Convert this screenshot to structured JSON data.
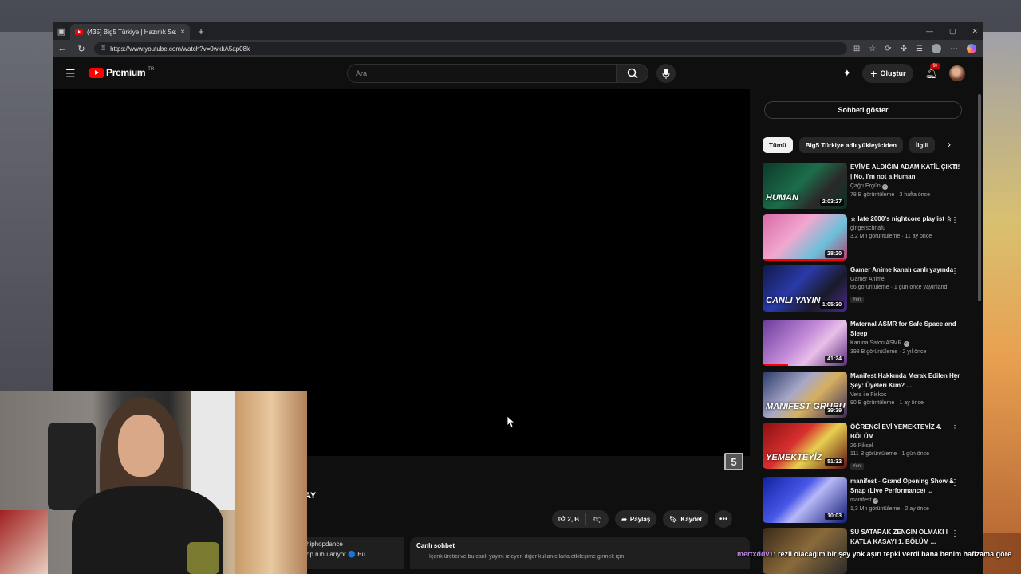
{
  "browser": {
    "tab_title": "(435) Big5 Türkiye | Hazırlık Sezon",
    "tab_close": "×",
    "new_tab": "+",
    "url": "https://www.youtube.com/watch?v=0wkkA5ap08k",
    "window_controls": [
      "—",
      "▢",
      "✕"
    ]
  },
  "header": {
    "logo_text": "Premium",
    "logo_country": "TR",
    "search_placeholder": "Ara",
    "create_label": "Oluştur",
    "notification_count": "9+"
  },
  "player": {
    "channel_logo_glyph": "5",
    "title_fragment": "AY"
  },
  "actions": {
    "like_count": "2, B",
    "share_label": "Paylaş",
    "save_label": "Kaydet"
  },
  "description": {
    "line1": "hiphopdance",
    "line2": "op ruhu arıyor 🔵 Bu"
  },
  "live_chat": {
    "title": "Canlı sohbet",
    "subtitle": "İçerik üretici ve bu canlı yayını izleyen diğer kullanıcılarla etkileşime girmek için"
  },
  "sidebar": {
    "show_chat_label": "Sohbeti göster",
    "chips": [
      "Tümü",
      "Big5 Türkiye adlı yükleyiciden",
      "İlgili"
    ],
    "recommendations": [
      {
        "title": "EVİME ALDIĞIM ADAM KATİL ÇIKTI! | No, I'm not a Human",
        "channel": "Çağrı Ergün",
        "verified": true,
        "meta": "78 B görüntüleme · 3 hafta önce",
        "duration": "2:03:27",
        "thumb_text": "HUMAN",
        "badge": "",
        "watched_fraction": 0
      },
      {
        "title": "☆ late 2000's nightcore playlist ☆",
        "channel": "gingerschnafu",
        "verified": false,
        "meta": "3,2 Mn görüntüleme · 11 ay önce",
        "duration": "28:20",
        "thumb_text": "",
        "badge": "",
        "watched_fraction": 1.0
      },
      {
        "title": "Gamer Anime kanalı canlı yayında",
        "channel": "Gamer Anime",
        "verified": false,
        "meta": "66 görüntüleme · 1 gün önce yayınlandı",
        "duration": "1:05:30",
        "thumb_text": "CANLI YAYIN",
        "badge": "Yeni",
        "watched_fraction": 0
      },
      {
        "title": "Maternal ASMR for Safe Space and Sleep",
        "channel": "Karuna Satori ASMR",
        "verified": true,
        "meta": "398 B görüntüleme · 2 yıl önce",
        "duration": "41:24",
        "thumb_text": "",
        "badge": "",
        "watched_fraction": 0.3
      },
      {
        "title": "Manifest Hakkında Merak Edilen Her Şey: Üyeleri Kim? ...",
        "channel": "Vera ile Fiskos",
        "verified": false,
        "meta": "90 B görüntüleme · 1 ay önce",
        "duration": "39:39",
        "thumb_text": "MANIFEST GRUBU",
        "badge": "",
        "watched_fraction": 0
      },
      {
        "title": "ÖĞRENCİ EVİ YEMEKTEYİZ 4. BÖLÜM",
        "channel": "26 Piksel",
        "verified": false,
        "meta": "111 B görüntüleme · 1 gün önce",
        "duration": "51:32",
        "thumb_text": "YEMEKTEYİZ",
        "badge": "Yeni",
        "watched_fraction": 0
      },
      {
        "title": "manifest - Grand Opening Show & Snap (Live Performance) ...",
        "channel": "manifest",
        "verified": true,
        "meta": "1,3 Mn görüntüleme · 2 ay önce",
        "duration": "10:03",
        "thumb_text": "",
        "badge": "",
        "watched_fraction": 0
      },
      {
        "title": "SU SATARAK ZENGİN OLMAKI İ KATLA KASAYI 1. BÖLÜM ...",
        "channel": "",
        "verified": false,
        "meta": "",
        "duration": "",
        "thumb_text": "",
        "badge": "",
        "watched_fraction": 0
      }
    ]
  },
  "stream_overlay": {
    "username": "mertxddv1",
    "message": ": rezil olacağım bir şey yok aşırı tepki verdi bana benim hafizama göre"
  }
}
